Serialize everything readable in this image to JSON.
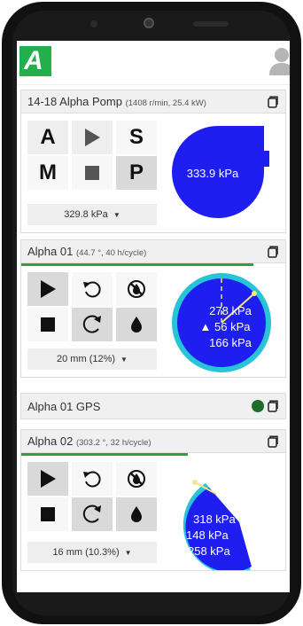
{
  "app": {
    "logo_letter": "A"
  },
  "pump_card": {
    "title": "14-18 Alpha Pomp",
    "subtitle": "(1408 r/min, 25.4 kW)",
    "buttons": [
      "A",
      "S",
      "M",
      "P"
    ],
    "pressure": "333.9 kPa",
    "dropdown": "329.8 kPa"
  },
  "alpha01": {
    "title": "Alpha 01",
    "subtitle": "(44.7 °, 40 h/cycle)",
    "progress_fraction": 0.88,
    "readings": [
      "278 kPa",
      "▲ 56 kPa",
      "166 kPa"
    ],
    "dropdown": "20 mm (12%)"
  },
  "alpha01_gps": {
    "title": "Alpha 01 GPS",
    "status_color": "#1e6e2b"
  },
  "alpha02": {
    "title": "Alpha 02",
    "subtitle": "(303.2 °, 32 h/cycle)",
    "progress_fraction": 0.63,
    "readings": [
      "318 kPa",
      "148 kPa",
      "258 kPa"
    ],
    "dropdown": "16 mm (10.3%)"
  },
  "colors": {
    "brand_green": "#21b04b",
    "gauge_blue": "#1e1ef0",
    "ring_cyan": "#27c3d6"
  }
}
